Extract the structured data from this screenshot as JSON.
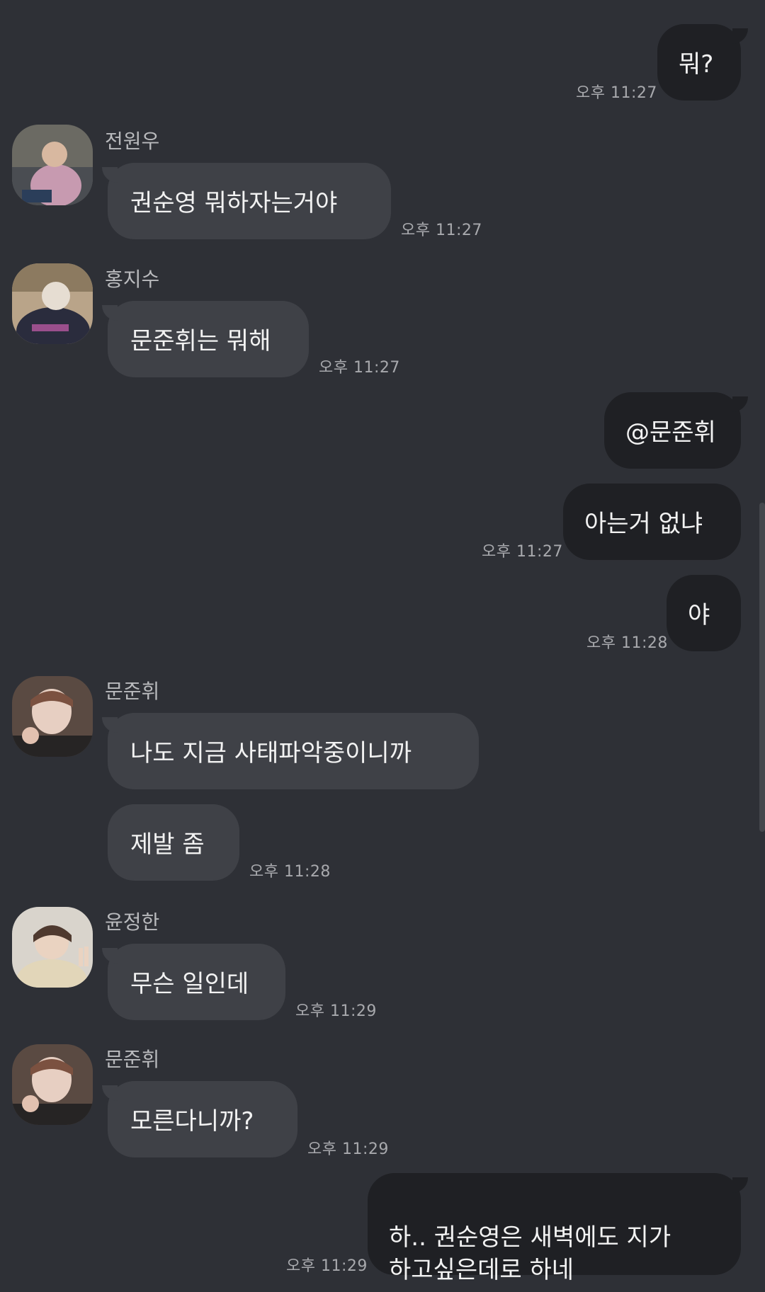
{
  "messages": [
    {
      "side": "out",
      "text": "뭐?",
      "time": "오후 11:27"
    },
    {
      "side": "in",
      "sender": "전원우",
      "avatar": "person-photo-icon",
      "text": "권순영 뭐하자는거야",
      "time": "오후 11:27"
    },
    {
      "side": "in",
      "sender": "홍지수",
      "avatar": "person-photo-icon",
      "text": "문준휘는 뭐해",
      "time": "오후 11:27"
    },
    {
      "side": "out",
      "text": "@문준휘"
    },
    {
      "side": "out",
      "text": "아는거 없냐",
      "time": "오후 11:27"
    },
    {
      "side": "out",
      "text": "야",
      "time": "오후 11:28"
    },
    {
      "side": "in",
      "sender": "문준휘",
      "avatar": "person-photo-icon",
      "text": "나도 지금 사태파악중이니까"
    },
    {
      "side": "in",
      "text": "제발 좀",
      "time": "오후 11:28"
    },
    {
      "side": "in",
      "sender": "윤정한",
      "avatar": "person-photo-icon",
      "text": "무슨 일인데",
      "time": "오후 11:29"
    },
    {
      "side": "in",
      "sender": "문준휘",
      "avatar": "person-photo-icon",
      "text": "모른다니까?",
      "time": "오후 11:29"
    },
    {
      "side": "out",
      "text": "하.. 권순영은 새벽에도 지가\n하고싶은데로 하네",
      "time": "오후 11:29"
    }
  ],
  "colors": {
    "background": "#2e3036",
    "incoming_bubble": "#3f4147",
    "outgoing_bubble": "#1f2024",
    "text": "#f2f2f2",
    "timestamp": "#a8a9ad"
  }
}
